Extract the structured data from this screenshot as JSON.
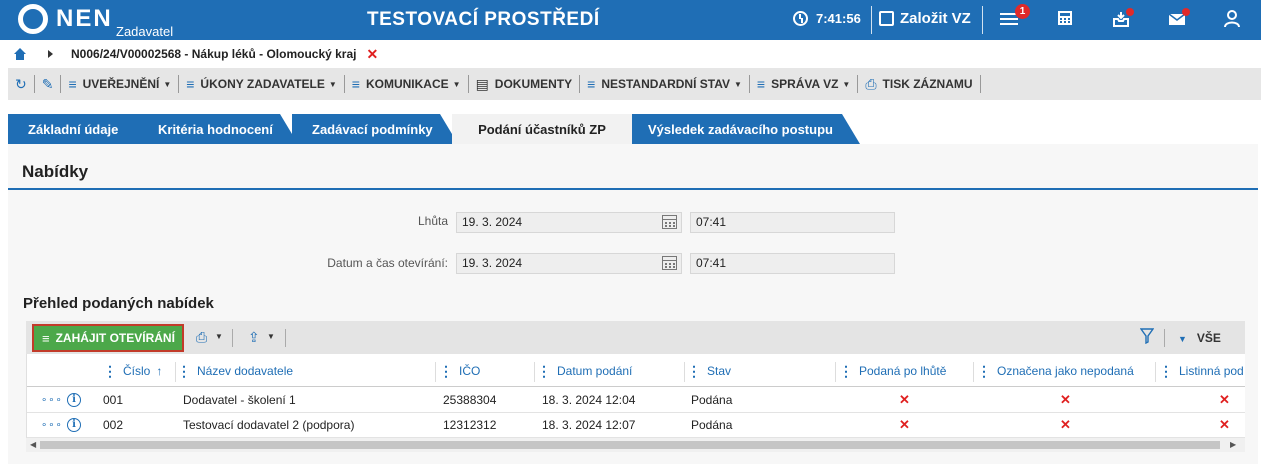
{
  "app": {
    "logo_text": "NEN",
    "logo_sub": "Zadavatel",
    "env_title": "TESTOVACÍ PROSTŘEDÍ",
    "time": "7:41:56",
    "create_label": "Založit VZ",
    "notification_count": "1"
  },
  "breadcrumb": {
    "path": "N006/24/V00002568 - Nákup léků - Olomoucký kraj",
    "close": "✕"
  },
  "toolbar": {
    "items": [
      {
        "label": "UVEŘEJNĚNÍ",
        "caret": true
      },
      {
        "label": "ÚKONY ZADAVATELE",
        "caret": true
      },
      {
        "label": "KOMUNIKACE",
        "caret": true
      },
      {
        "label": "DOKUMENTY",
        "caret": false
      },
      {
        "label": "NESTANDARDNÍ STAV",
        "caret": true
      },
      {
        "label": "SPRÁVA VZ",
        "caret": true
      },
      {
        "label": "TISK ZÁZNAMU",
        "caret": false
      }
    ]
  },
  "tabs": [
    {
      "label": "Základní údaje",
      "active": false
    },
    {
      "label": "Kritéria hodnocení",
      "active": false
    },
    {
      "label": "Zadávací podmínky",
      "active": false
    },
    {
      "label": "Podání účastníků ZP",
      "active": true
    },
    {
      "label": "Výsledek zadávacího postupu",
      "active": false
    }
  ],
  "section": {
    "title": "Nabídky",
    "deadline_label": "Lhůta",
    "deadline_date": "19. 3. 2024",
    "deadline_time": "07:41",
    "opening_label": "Datum a čas otevírání:",
    "opening_date": "19. 3. 2024",
    "opening_time": "07:41"
  },
  "bids": {
    "title": "Přehled podaných nabídek",
    "start_button": "ZAHÁJIT OTEVÍRÁNÍ",
    "view_all": "VŠE",
    "columns": [
      "Číslo",
      "Název dodavatele",
      "IČO",
      "Datum podání",
      "Stav",
      "Podaná po lhůtě",
      "Označena jako nepodaná",
      "Listinná pod"
    ],
    "sort_indicator": "↑",
    "rows": [
      {
        "number": "001",
        "supplier": "Dodavatel - školení 1",
        "ico": "25388304",
        "submitted": "18. 3. 2024 12:04",
        "status": "Podána",
        "late": "✕",
        "unsubmitted": "✕",
        "paper": "✕"
      },
      {
        "number": "002",
        "supplier": "Testovací dodavatel 2 (podpora)",
        "ico": "12312312",
        "submitted": "18. 3. 2024 12:07",
        "status": "Podána",
        "late": "✕",
        "unsubmitted": "✕",
        "paper": "✕"
      }
    ]
  },
  "colors": {
    "brand_blue": "#1f6eb5",
    "start_green": "#4ca84a",
    "error_red": "#e02020"
  }
}
